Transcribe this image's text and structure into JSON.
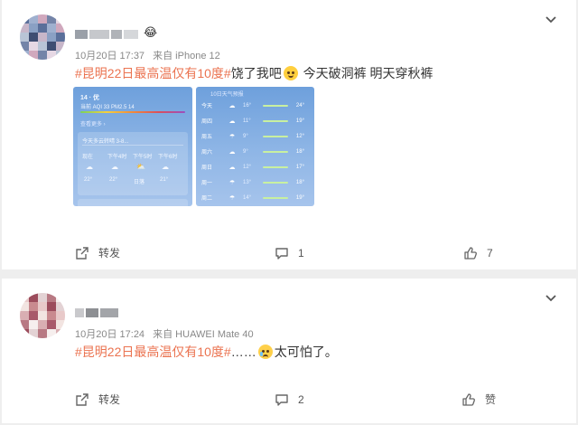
{
  "posts": [
    {
      "username_emoji": "😂",
      "time": "10月20日 17:37",
      "source": "来自 iPhone 12",
      "topic": "#昆明22日最高温仅有10度#",
      "text_after_topic": "饶了我吧",
      "text_after_emoji": " 今天破洞裤 明天穿秋裤",
      "emoji_icon": "laugh-cry-emoji",
      "images": [
        {
          "location": "14 · 优",
          "aqi": "当前 AQI 33 PM2.5 14",
          "summary": "今天多云转晴 3-8...",
          "hours": [
            "现在",
            "下午4时",
            "下午5时",
            "下午6时"
          ],
          "temps": [
            "22°",
            "22°",
            "日落",
            "21°"
          ]
        },
        {
          "header": "10日天气预报",
          "forecast": [
            {
              "day": "今天",
              "lo": "16°",
              "hi": "24°"
            },
            {
              "day": "周四",
              "lo": "11°",
              "hi": "19°"
            },
            {
              "day": "周五",
              "lo": "9°",
              "hi": "12°"
            },
            {
              "day": "周六",
              "lo": "9°",
              "hi": "18°"
            },
            {
              "day": "周日",
              "lo": "12°",
              "hi": "17°"
            },
            {
              "day": "周一",
              "lo": "13°",
              "hi": "18°"
            },
            {
              "day": "周二",
              "lo": "14°",
              "hi": "19°"
            }
          ]
        }
      ],
      "repost_label": "转发",
      "comment_count": "1",
      "like_label": "7"
    },
    {
      "time": "10月20日 17:24",
      "source": "来自 HUAWEI Mate 40",
      "topic": "#昆明22日最高温仅有10度#",
      "text_after_topic": "……",
      "text_after_emoji": "太可怕了。",
      "emoji_icon": "scared-emoji",
      "repost_label": "转发",
      "comment_count": "2",
      "like_label": "赞"
    }
  ],
  "colors": {
    "topic": "#eb7350",
    "meta": "#888888",
    "background": "#eeeeee"
  }
}
